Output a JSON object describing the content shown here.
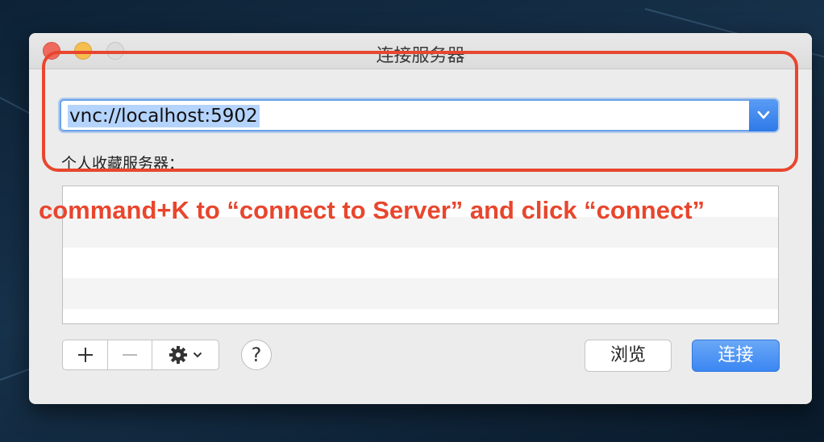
{
  "window": {
    "title": "连接服务器"
  },
  "server_address": {
    "value": "vnc://localhost:5902"
  },
  "favorites": {
    "label": "个人收藏服务器：",
    "items": []
  },
  "annotation": {
    "text": "command+K to “connect to Server” and click “connect”",
    "color": "#e8462d"
  },
  "toolbar": {
    "add_icon": "plus-icon",
    "remove_icon": "minus-icon",
    "action_icon": "gear-icon",
    "help_label": "?"
  },
  "buttons": {
    "browse_label": "浏览",
    "connect_label": "连接"
  },
  "colors": {
    "accent": "#3a86f2",
    "selection": "#b5d4fd"
  }
}
